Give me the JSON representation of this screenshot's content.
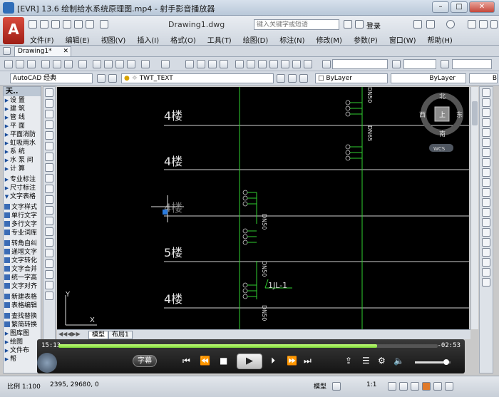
{
  "player": {
    "title": "[EVR] 13.6 绘制给水系统原理图.mp4 - 射手影音播放器",
    "time_elapsed": "15:13",
    "time_remaining": "-02:53",
    "progress": 0.84,
    "volume": 0.8,
    "subtitle_label": "字幕"
  },
  "acad": {
    "logo": "A",
    "doc_title": "Drawing1.dwg",
    "search_placeholder": "键入关键字或短语",
    "login_label": "登录",
    "menu": [
      "文件(F)",
      "编辑(E)",
      "视图(V)",
      "插入(I)",
      "格式(O)",
      "工具(T)",
      "绘图(D)",
      "标注(N)",
      "修改(M)",
      "参数(P)",
      "窗口(W)",
      "帮助(H)"
    ],
    "file_tab": "Drawing1*",
    "workspace": "AutoCAD 经典",
    "layer": "TWT_TEXT",
    "color": "ByLayer",
    "linetype": "ByLayer",
    "lineweight": "B"
  },
  "panel": {
    "header": "天..",
    "items": [
      "设 置",
      "建 筑",
      "管 线",
      "平 面",
      "平面消防",
      "虹吸雨水",
      "系 统",
      "水 泵 间",
      "计 算",
      "专业标注",
      "尺寸标注",
      "文字表格",
      "文字样式",
      "单行文字",
      "多行文字",
      "专业词库",
      "转角自纠",
      "递增文字",
      "文字转化",
      "文字合并",
      "统一字高",
      "文字对齐",
      "新建表格",
      "表格编辑",
      "查找替换",
      "繁简转换",
      "图库图",
      "绘图",
      "文件布",
      "帮"
    ]
  },
  "drawing": {
    "floors": [
      "4楼",
      "4楼",
      "4楼",
      "5楼",
      "4楼"
    ],
    "pipe_labels": [
      "DN50",
      "DN65",
      "DN50",
      "DN50",
      "DN50",
      "DN50"
    ],
    "riser_label": "1JL-1",
    "compass": {
      "north": "北",
      "south": "南",
      "east": "东",
      "west": "西",
      "top": "上",
      "wcs": "WCS"
    },
    "ucs": {
      "x": "X",
      "y": "Y"
    }
  },
  "layout_tabs": [
    "模型",
    "布局1"
  ],
  "status": {
    "scale": "比例 1:100",
    "coords": "2395, 29680, 0",
    "model": "模型",
    "annotation_scale": "1:1"
  }
}
